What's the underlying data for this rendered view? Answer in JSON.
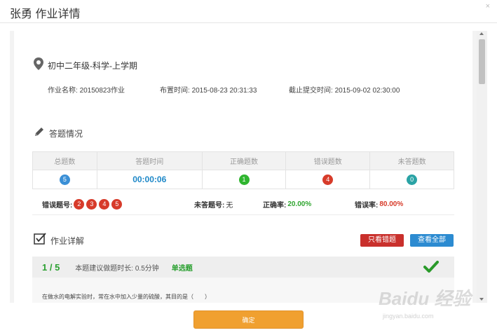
{
  "dialog": {
    "title": "张勇 作业详情",
    "close": "×"
  },
  "assignment": {
    "grade": "初中二年级-科学-上学期",
    "name_label": "作业名称:",
    "name": "20150823作业",
    "assigned_label": "布置时间:",
    "assigned_time": "2015-08-23 20:31:33",
    "deadline_label": "截止提交时间:",
    "deadline_time": "2015-09-02 02:30:00"
  },
  "answer_section": {
    "title": "答题情况",
    "headers": [
      "总题数",
      "答题时间",
      "正确题数",
      "错误题数",
      "未答题数"
    ],
    "values": {
      "total": "5",
      "time": "00:00:06",
      "correct": "1",
      "wrong": "4",
      "unanswered": "0"
    },
    "colors": {
      "total": "#3a8fd6",
      "correct": "#2fb52f",
      "wrong": "#d73b2a",
      "unanswered": "#2aa3a5",
      "time": "#1e88c8"
    }
  },
  "summary": {
    "wrong_label": "错误题号:",
    "wrong_numbers": [
      "2",
      "3",
      "4",
      "5"
    ],
    "unanswered_label": "未答题号:",
    "unanswered_value": "无",
    "accuracy_label": "正确率:",
    "accuracy_value": "20.00%",
    "error_label": "错误率:",
    "error_value": "80.00%"
  },
  "details_section": {
    "title": "作业详解",
    "only_wrong_button": "只看错题",
    "view_all_button": "查看全部"
  },
  "question": {
    "index": "1 / 5",
    "suggested_time": "本题建议做题时长: 0.5分钟",
    "type": "单选题",
    "text": "在做水的电解实验时，常在水中加入少量的硫酸，其目的是（　　）",
    "correct_color": "#2a9a2a"
  },
  "footer": {
    "confirm_button": "确定"
  },
  "watermark": {
    "brand": "Baidu 经验",
    "url": "jingyan.baidu.com"
  }
}
